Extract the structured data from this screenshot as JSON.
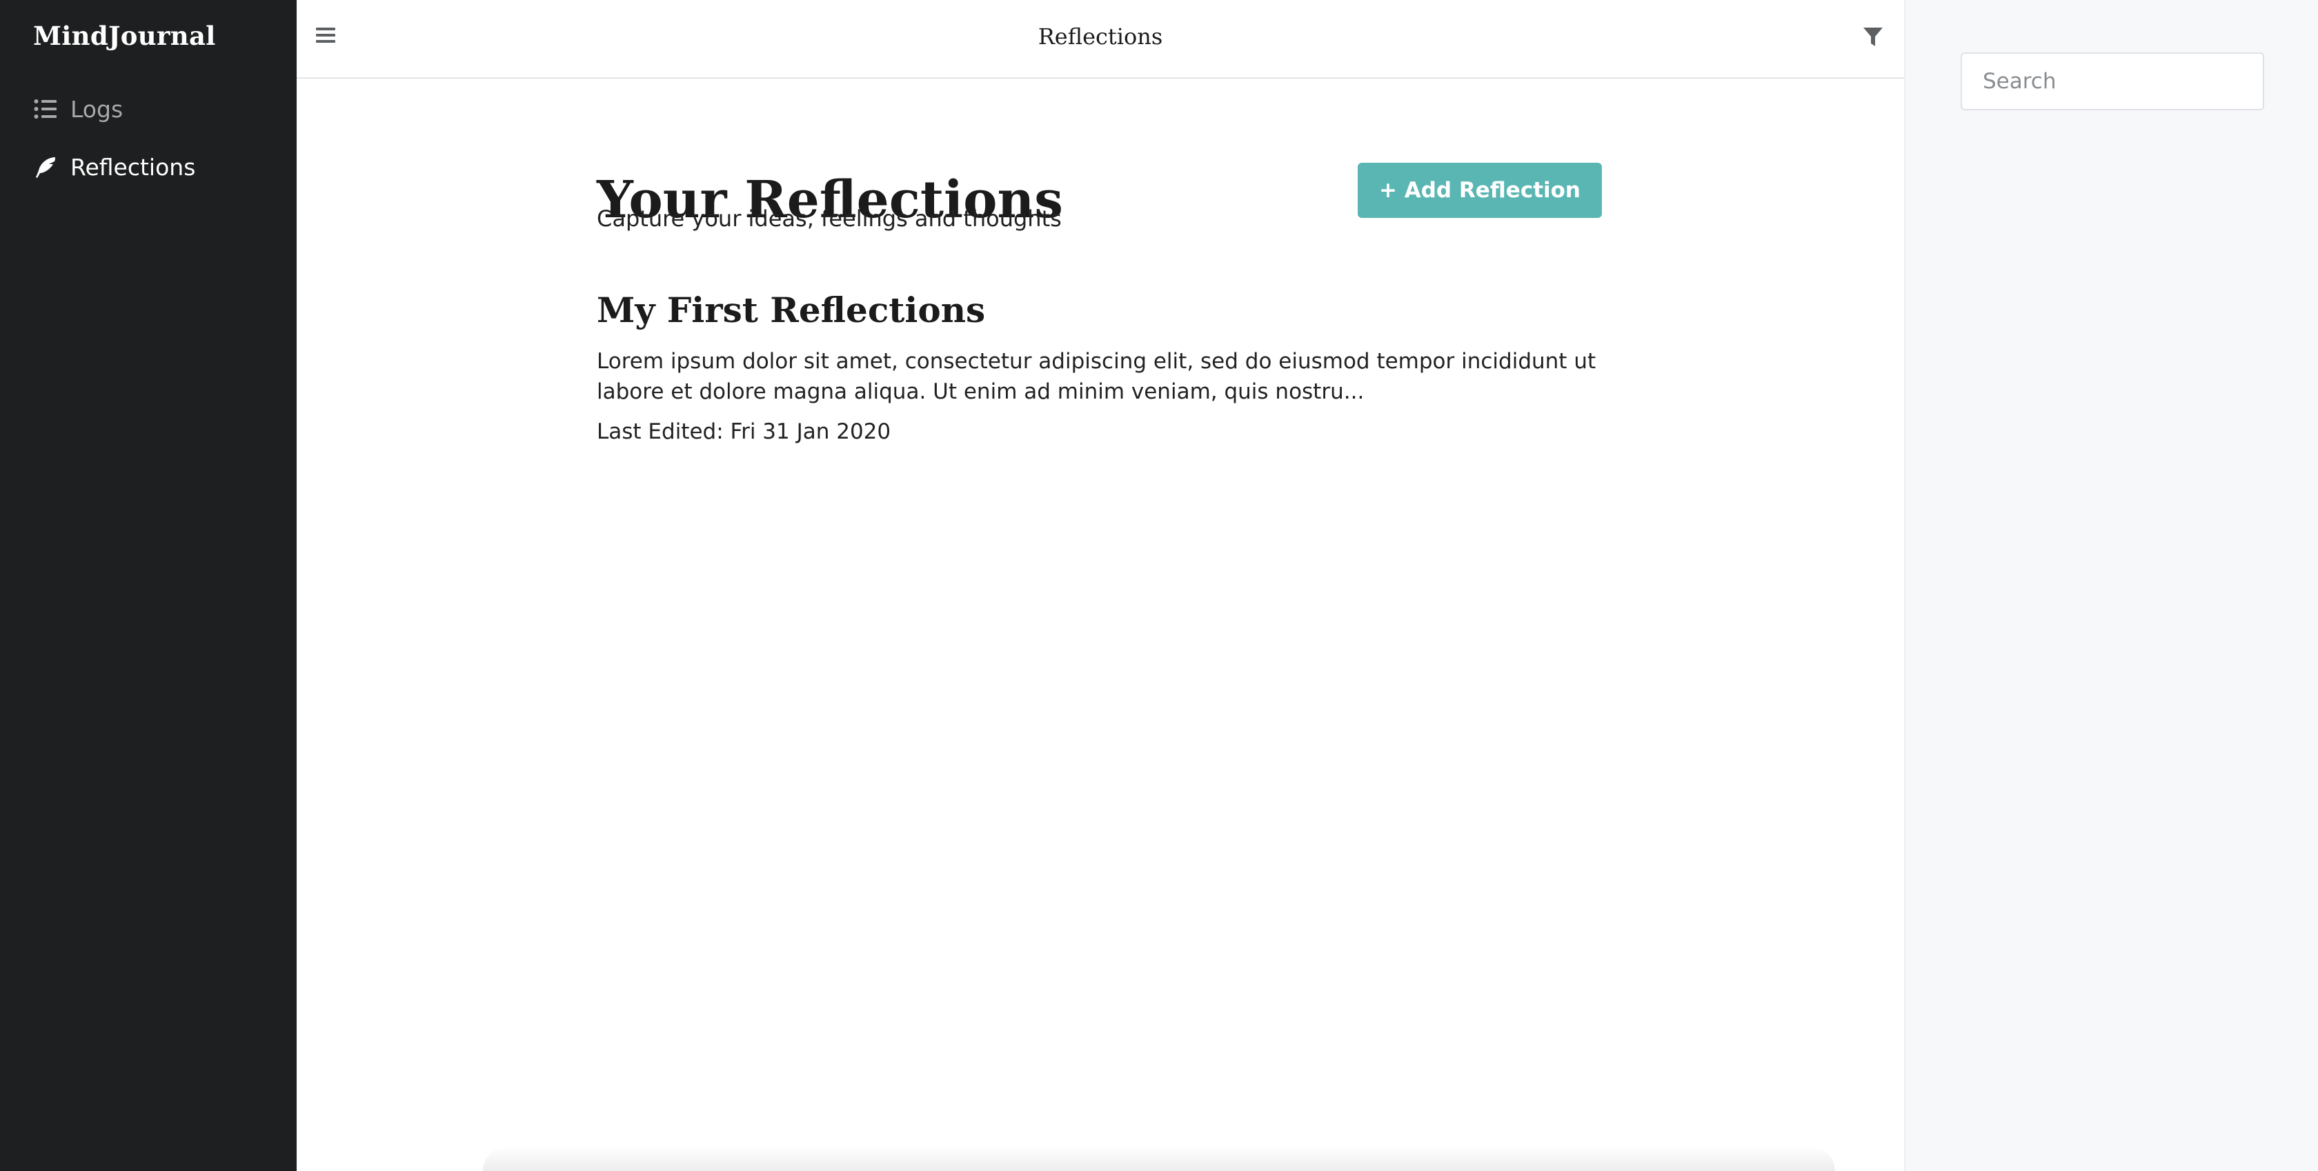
{
  "app": {
    "brand": "MindJournal"
  },
  "sidebar": {
    "items": [
      {
        "label": "Logs",
        "icon": "list-icon",
        "active": false
      },
      {
        "label": "Reflections",
        "icon": "feather-pen-icon",
        "active": true
      }
    ]
  },
  "header": {
    "title": "Reflections",
    "menu_icon": "hamburger-menu-icon",
    "filter_icon": "filter-icon"
  },
  "main": {
    "title": "Your Reflections",
    "subtitle": "Capture your ideas, feelings and thoughts",
    "add_button_label": "+ Add Reflection",
    "entries": [
      {
        "title": "My First Reflections",
        "excerpt": "Lorem ipsum dolor sit amet, consectetur adipiscing elit, sed do eiusmod tempor incididunt ut labore et dolore magna aliqua. Ut enim ad minim veniam, quis nostru...",
        "last_edited": "Last Edited: Fri 31 Jan 2020"
      }
    ]
  },
  "search": {
    "placeholder": "Search",
    "value": ""
  },
  "colors": {
    "sidebar_bg": "#1e1f20",
    "accent": "#5ab6b3",
    "right_panel_bg": "#f7f8f9"
  }
}
